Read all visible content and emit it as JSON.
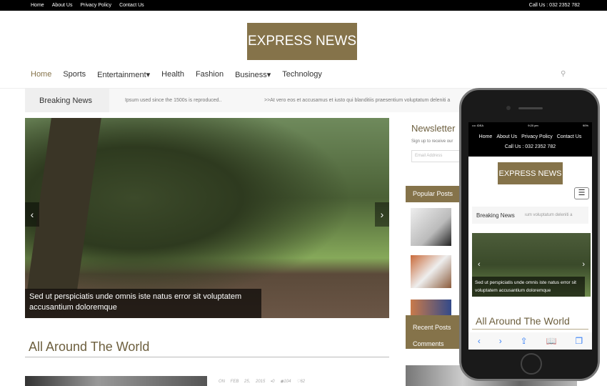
{
  "topbar": {
    "links": [
      "Home",
      "About Us",
      "Privacy Policy",
      "Contact Us"
    ],
    "call": "Call Us : 032 2352 782"
  },
  "logo": "EXPRESS NEWS",
  "nav": {
    "items": [
      "Home",
      "Sports",
      "Entertainment▾",
      "Health",
      "Fashion",
      "Business▾",
      "Technology"
    ],
    "active": "Home"
  },
  "breaking": {
    "label": "Breaking News",
    "items": [
      "Ipsum used since the 1500s is reproduced..",
      ">>At vero eos et accusamus et iusto qui blanditiis praesentium voluptatum deleniti a"
    ]
  },
  "slider": {
    "caption": "Sed ut perspiciatis unde omnis iste natus error sit voluptatem accusantium doloremque",
    "prev": "‹",
    "next": "›"
  },
  "section": {
    "title": "All Around The World",
    "meta": {
      "date": "ON FEB 25, 2015",
      "comments": "0",
      "views": "104",
      "likes": "62"
    }
  },
  "sidebar": {
    "newsletter_title": "Newsletter",
    "newsletter_text": "Sign up to receive our",
    "email_placeholder": "Email Address",
    "popular": "Popular Posts",
    "recent": "Recent Posts",
    "comments": "Comments"
  },
  "phone": {
    "carrier": "•••• IDEA",
    "time": "9:20 pm",
    "battery": "90%",
    "links": [
      "Home",
      "About Us",
      "Privacy Policy",
      "Contact Us"
    ],
    "call": "Call Us : 032 2352 782",
    "logo": "EXPRESS NEWS",
    "breaking_label": "Breaking News",
    "breaking_text": "ıum voluptatum deleniti a",
    "caption": "Sed ut perspiciatis unde omnis iste natus error sit voluptatem accusantium doloremque",
    "section": "All Around The World"
  },
  "colors": {
    "brand": "#85734a",
    "topbar": "#000000"
  }
}
